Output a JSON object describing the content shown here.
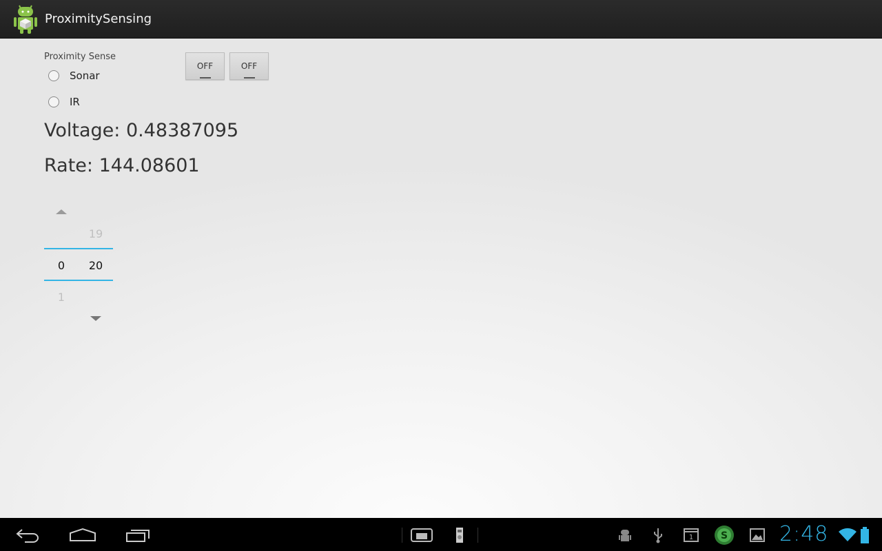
{
  "app": {
    "title": "ProximitySensing"
  },
  "proximity": {
    "label": "Proximity Sense",
    "options": [
      "Sonar",
      "IR"
    ],
    "selected": null
  },
  "toggles": [
    {
      "label": "OFF",
      "state": "off"
    },
    {
      "label": "OFF",
      "state": "off"
    }
  ],
  "readings": {
    "voltage": "Voltage: 0.48387095",
    "rate": "Rate: 144.08601"
  },
  "number_picker": {
    "left": {
      "prev": "",
      "current": "0",
      "next": "1"
    },
    "right": {
      "prev": "19",
      "current": "20",
      "next": ""
    }
  },
  "status_bar": {
    "time": "2:48",
    "accent_color": "#33b5e5"
  },
  "nav": {
    "icons": [
      "back-icon",
      "home-icon",
      "recent-apps-icon"
    ]
  }
}
